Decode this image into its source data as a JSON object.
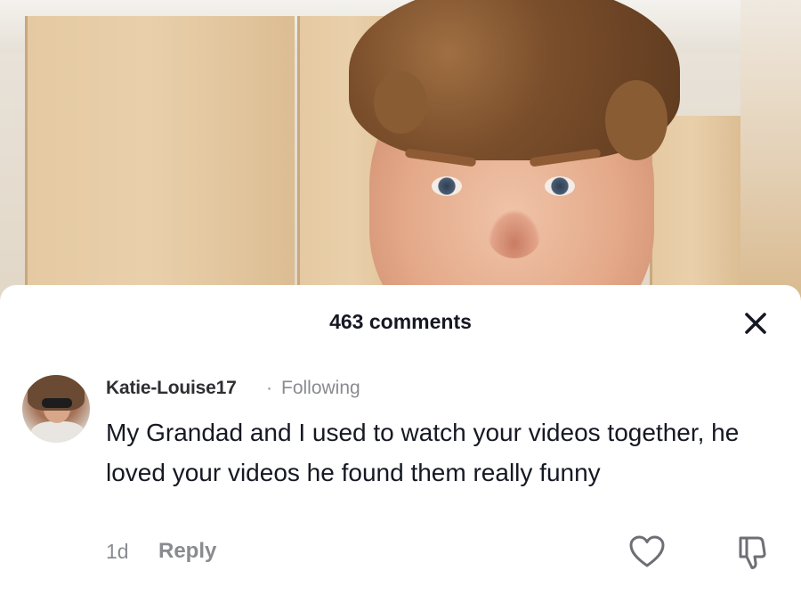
{
  "video": {
    "description_icon": "video-frame"
  },
  "comments_sheet": {
    "title": "463 comments",
    "close_icon": "close-icon"
  },
  "comment": {
    "avatar_icon": "avatar",
    "username": "Katie-Louise17",
    "separator": "·",
    "relationship": "Following",
    "text": "My Grandad and I used to watch your videos together, he loved your videos he found them really funny",
    "age": "1d",
    "reply_label": "Reply",
    "like_icon": "heart-outline-icon",
    "dislike_icon": "thumbs-down-icon"
  },
  "colors": {
    "primary_text": "#161823",
    "secondary_text": "#8a8b91",
    "background": "#ffffff"
  }
}
